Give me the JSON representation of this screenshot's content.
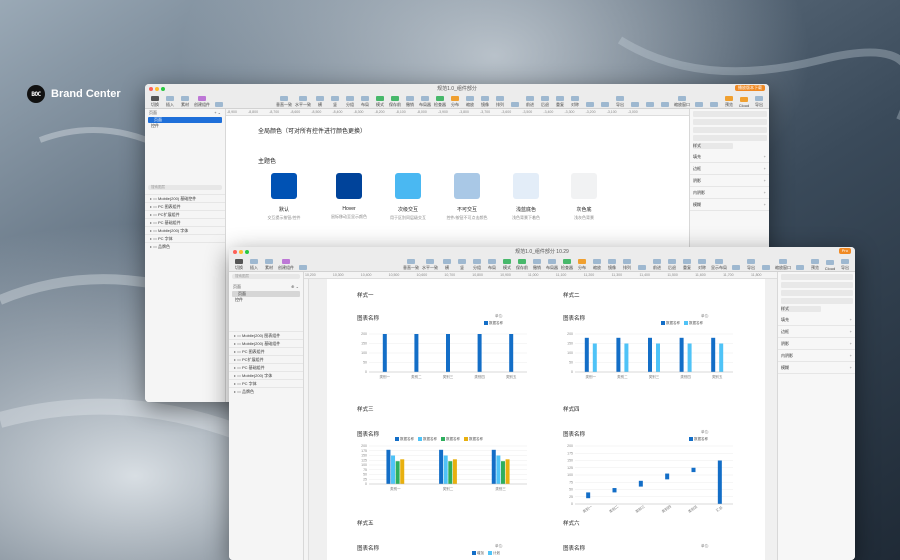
{
  "brand": {
    "logo_text": "BOC",
    "name": "Brand Center"
  },
  "colors": {
    "primary": "#0052b4",
    "chart_blue": "#136ec7",
    "chart_cyan": "#4fc3f7",
    "chart_green": "#2eae5d",
    "chart_yellow": "#e8b00f",
    "accent": "#1e6fd9"
  },
  "win1": {
    "title": "规范1.0_组件部分",
    "pro_badge": "播放版本下载",
    "toolbar": [
      "切换",
      "插入",
      "素材",
      "创建组件",
      "",
      "垂直一致",
      "水平一致",
      "横",
      "竖",
      "分组",
      "布局",
      "模式",
      "保存前",
      "撤销",
      "布局器",
      "检查器",
      "分布",
      "缩放",
      "镜像",
      "排列",
      "",
      "前进",
      "后退",
      "重复",
      "对称",
      "",
      "",
      "导出",
      "",
      "",
      "",
      "缩放窗口",
      "",
      "",
      "预览",
      "Cloud",
      "导出"
    ],
    "ruler": [
      "-8,900",
      "-8,800",
      "-8,700",
      "-8,600",
      "-8,500",
      "-8,400",
      "-8,300",
      "-8,200",
      "-8,100",
      "-8,000",
      "-3,900",
      "-3,800",
      "-3,700",
      "-3,600",
      "-3,500",
      "-3,400",
      "-3,300",
      "-3,200",
      "-3,100",
      "-3,000",
      "",
      ""
    ],
    "sidebar": {
      "pages_label": "页面",
      "pages": [
        "页面",
        "控件"
      ],
      "search": "搜索图层",
      "layers": [
        "Mobile(200) 基础控件",
        "PC 图表组件",
        "PC扩展组件",
        "PC 基础组件",
        "Mobile(200) 字体",
        "PC 字体",
        "品牌色"
      ]
    },
    "inspector": {
      "rows": [
        "填充",
        "边框",
        "阴影",
        "内阴影",
        "模糊"
      ],
      "section": "样式"
    },
    "content": {
      "heading": "全局颜色（可对所有控件进行颜色更换）",
      "theme_heading": "主题色",
      "swatches": [
        {
          "name": "默认",
          "desc": "交互提示按钮/控件",
          "color": "#0052b4"
        },
        {
          "name": "Hover",
          "desc": "鼠标移动至显示颜色",
          "color": "#00439a"
        },
        {
          "name": "次级交互",
          "desc": "用于区别同层级交互",
          "color": "#4ab8f2"
        },
        {
          "name": "不可交互",
          "desc": "控件/按钮不可点击颜色",
          "color": "#a9c8e6"
        },
        {
          "name": "浅蓝底色",
          "desc": "浅色背景下着色",
          "color": "#e3edf8"
        },
        {
          "name": "灰色底",
          "desc": "浅灰色背景",
          "color": "#f1f2f3"
        }
      ]
    }
  },
  "win2": {
    "title": "规范1.0_组件部分 10.29",
    "pro_badge": "Pro",
    "toolbar": [
      "切换",
      "插入",
      "素材",
      "创建组件",
      "",
      "垂直一致",
      "水平一致",
      "横",
      "竖",
      "分组",
      "布局",
      "模式",
      "保存前",
      "撤销",
      "布局器",
      "检查器",
      "分布",
      "缩放",
      "镜像",
      "排列",
      "",
      "前进",
      "后退",
      "重复",
      "对称",
      "显示布局",
      "",
      "导出",
      "",
      "缩放窗口",
      "",
      "预览",
      "Cloud",
      "导出"
    ],
    "zoom": "100%",
    "ruler": [
      "10,200",
      "10,300",
      "10,400",
      "10,500",
      "10,600",
      "10,700",
      "10,800",
      "10,900",
      "11,000",
      "11,100",
      "11,200",
      "11,300",
      "11,400",
      "11,500",
      "11,600",
      "11,700",
      "11,800"
    ],
    "vruler": [
      "2,500",
      "2,600",
      "2,700",
      "2,800",
      "2,900",
      "3,000"
    ],
    "sidebar": {
      "pages_label": "页面",
      "pages": [
        "页面",
        "控件"
      ],
      "search": "搜索图层",
      "layers": [
        "Mobile(200) 图表组件",
        "Mobile(200) 基础组件",
        "PC 图表组件",
        "PC扩展组件",
        "PC 基础组件",
        "Mobile(200) 字体",
        "PC 字体",
        "品牌色"
      ]
    },
    "inspector": {
      "section": "样式",
      "rows": [
        "填充",
        "边框",
        "阴影",
        "内阴影",
        "模糊"
      ]
    },
    "style_titles": [
      "样式一",
      "样式二",
      "样式三",
      "样式四",
      "样式五",
      "样式六"
    ],
    "chart_title": "图表名称",
    "unit_label": "单位:",
    "legend_single": "数据名称",
    "legend_multi": [
      "数据名称",
      "数据名称",
      "数据名称",
      "数据名称"
    ],
    "legend_s5": [
      "增加",
      "计划"
    ]
  },
  "chart_data": [
    {
      "type": "bar",
      "title": "图表名称",
      "categories": [
        "类别一",
        "类别二",
        "类别三",
        "类别四",
        "类别五"
      ],
      "series": [
        {
          "name": "数据名称",
          "values": [
            200,
            200,
            200,
            200,
            200
          ]
        }
      ],
      "ylim": [
        0,
        200
      ],
      "yticks": [
        0,
        50,
        100,
        150,
        200
      ]
    },
    {
      "type": "bar",
      "title": "图表名称",
      "categories": [
        "类别一",
        "类别二",
        "类别三",
        "类别四",
        "类别五"
      ],
      "series": [
        {
          "name": "数据名称",
          "values": [
            180,
            180,
            180,
            180,
            180
          ]
        },
        {
          "name": "数据名称",
          "values": [
            150,
            150,
            150,
            150,
            150
          ]
        }
      ],
      "ylim": [
        0,
        200
      ],
      "yticks": [
        0,
        50,
        100,
        150,
        200
      ]
    },
    {
      "type": "bar",
      "title": "图表名称",
      "categories": [
        "类别一",
        "类别二",
        "类别三"
      ],
      "series": [
        {
          "name": "数据名称",
          "values": [
            180,
            180,
            180
          ]
        },
        {
          "name": "数据名称",
          "values": [
            150,
            150,
            150
          ]
        },
        {
          "name": "数据名称",
          "values": [
            120,
            120,
            120
          ]
        },
        {
          "name": "数据名称",
          "values": [
            130,
            130,
            130
          ]
        }
      ],
      "ylim": [
        0,
        200
      ],
      "yticks": [
        0,
        25,
        50,
        75,
        100,
        125,
        150,
        175,
        200
      ]
    },
    {
      "type": "bar",
      "title": "图表名称",
      "categories": [
        "类别一",
        "类别二",
        "类别三",
        "类别四",
        "类别五",
        "汇总"
      ],
      "series": [
        {
          "name": "数据名称",
          "values": [
            [
              20,
              40
            ],
            [
              40,
              55
            ],
            [
              60,
              80
            ],
            [
              85,
              105
            ],
            [
              110,
              125
            ],
            [
              0,
              150
            ]
          ]
        }
      ],
      "ylim": [
        0,
        200
      ],
      "yticks": [
        0,
        25,
        50,
        75,
        100,
        125,
        150,
        175,
        200
      ]
    }
  ]
}
